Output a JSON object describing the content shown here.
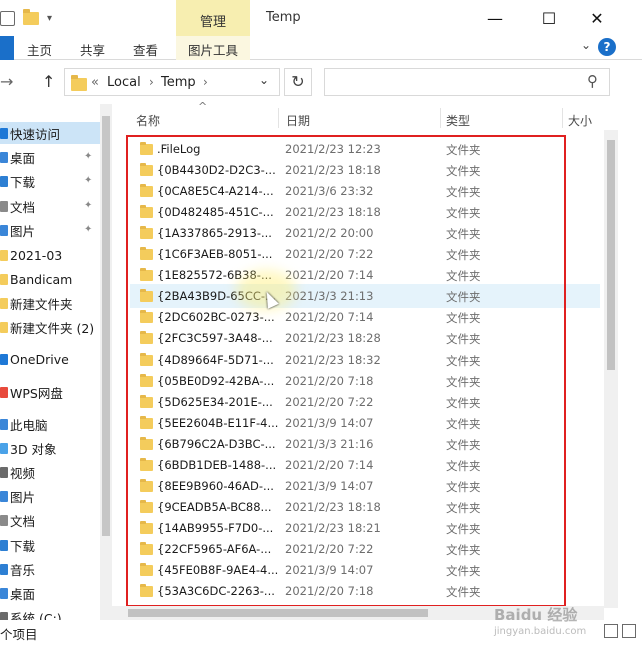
{
  "window": {
    "title": "Temp",
    "context_group": "管理",
    "minimize_glyph": "—",
    "maximize_glyph": "☐",
    "close_glyph": "✕"
  },
  "ribbon": {
    "tabs": [
      "主页",
      "共享",
      "查看"
    ],
    "context_tab": "图片工具",
    "collapse_glyph": "⌄",
    "help_glyph": "?"
  },
  "nav": {
    "back_glyph": "→",
    "up_glyph": "↑",
    "breadcrumb_prefix": "«",
    "breadcrumbs": [
      "Local",
      "Temp"
    ],
    "separator": "›",
    "dropdown_glyph": "⌄",
    "refresh_glyph": "↻",
    "search_placeholder": "",
    "search_glyph": "⚲"
  },
  "sidebar": {
    "items": [
      {
        "label": "快速访问",
        "icon": "star-icon",
        "color": "#1e78d6",
        "pinned": false,
        "active": true
      },
      {
        "label": "桌面",
        "icon": "desktop-icon",
        "color": "#3a86d8",
        "pinned": true,
        "active": false
      },
      {
        "label": "下载",
        "icon": "download-icon",
        "color": "#2d7fd3",
        "pinned": true,
        "active": false
      },
      {
        "label": "文档",
        "icon": "document-icon",
        "color": "#8a8a8a",
        "pinned": true,
        "active": false
      },
      {
        "label": "图片",
        "icon": "picture-icon",
        "color": "#3a86d8",
        "pinned": true,
        "active": false
      },
      {
        "label": "2021-03",
        "icon": "folder-icon",
        "color": "#f4cc5c",
        "pinned": false,
        "active": false
      },
      {
        "label": "Bandicam",
        "icon": "folder-icon",
        "color": "#f4cc5c",
        "pinned": false,
        "active": false
      },
      {
        "label": "新建文件夹",
        "icon": "folder-icon",
        "color": "#f4cc5c",
        "pinned": false,
        "active": false
      },
      {
        "label": "新建文件夹 (2)",
        "icon": "folder-icon",
        "color": "#f4cc5c",
        "pinned": false,
        "active": false
      },
      {
        "label": "OneDrive",
        "icon": "cloud-icon",
        "color": "#1e78d6",
        "pinned": false,
        "active": false
      },
      {
        "label": "WPS网盘",
        "icon": "cloud-icon",
        "color": "#e84a3c",
        "pinned": false,
        "active": false
      },
      {
        "label": "此电脑",
        "icon": "computer-icon",
        "color": "#3a86d8",
        "pinned": false,
        "active": false
      },
      {
        "label": "3D 对象",
        "icon": "cube-icon",
        "color": "#4aa2e8",
        "pinned": false,
        "active": false
      },
      {
        "label": "视频",
        "icon": "video-icon",
        "color": "#6a6a6a",
        "pinned": false,
        "active": false
      },
      {
        "label": "图片",
        "icon": "picture-icon",
        "color": "#3a86d8",
        "pinned": false,
        "active": false
      },
      {
        "label": "文档",
        "icon": "document-icon",
        "color": "#8a8a8a",
        "pinned": false,
        "active": false
      },
      {
        "label": "下载",
        "icon": "download-icon",
        "color": "#2d7fd3",
        "pinned": false,
        "active": false
      },
      {
        "label": "音乐",
        "icon": "music-icon",
        "color": "#2d7fd3",
        "pinned": false,
        "active": false
      },
      {
        "label": "桌面",
        "icon": "desktop-icon",
        "color": "#3a86d8",
        "pinned": false,
        "active": false
      },
      {
        "label": "系统 (C:)",
        "icon": "drive-icon",
        "color": "#6a6a6a",
        "pinned": false,
        "active": false
      }
    ],
    "pin_glyph": "✦"
  },
  "columns": {
    "name": "名称",
    "date": "日期",
    "type": "类型",
    "size": "大小",
    "sort_glyph": "^"
  },
  "files": [
    {
      "name": ".FileLog",
      "date": "2021/2/23 12:23",
      "type": "文件夹"
    },
    {
      "name": "{0B4430D2-D2C3-...",
      "date": "2021/2/23 18:18",
      "type": "文件夹"
    },
    {
      "name": "{0CA8E5C4-A214-...",
      "date": "2021/3/6 23:32",
      "type": "文件夹"
    },
    {
      "name": "{0D482485-451C-...",
      "date": "2021/2/23 18:18",
      "type": "文件夹"
    },
    {
      "name": "{1A337865-2913-...",
      "date": "2021/2/2 20:00",
      "type": "文件夹"
    },
    {
      "name": "{1C6F3AEB-8051-...",
      "date": "2021/2/20 7:22",
      "type": "文件夹"
    },
    {
      "name": "{1E825572-6B38-...",
      "date": "2021/2/20 7:14",
      "type": "文件夹"
    },
    {
      "name": "{2BA43B9D-65CC-...",
      "date": "2021/3/3 21:13",
      "type": "文件夹"
    },
    {
      "name": "{2DC602BC-0273-...",
      "date": "2021/2/20 7:14",
      "type": "文件夹"
    },
    {
      "name": "{2FC3C597-3A48-...",
      "date": "2021/2/23 18:28",
      "type": "文件夹"
    },
    {
      "name": "{4D89664F-5D71-...",
      "date": "2021/2/23 18:32",
      "type": "文件夹"
    },
    {
      "name": "{05BE0D92-42BA-...",
      "date": "2021/2/20 7:18",
      "type": "文件夹"
    },
    {
      "name": "{5D625E34-201E-...",
      "date": "2021/2/20 7:22",
      "type": "文件夹"
    },
    {
      "name": "{5EE2604B-E11F-4...",
      "date": "2021/3/9 14:07",
      "type": "文件夹"
    },
    {
      "name": "{6B796C2A-D3BC-...",
      "date": "2021/3/3 21:16",
      "type": "文件夹"
    },
    {
      "name": "{6BDB1DEB-1488-...",
      "date": "2021/2/20 7:14",
      "type": "文件夹"
    },
    {
      "name": "{8EE9B960-46AD-...",
      "date": "2021/3/9 14:07",
      "type": "文件夹"
    },
    {
      "name": "{9CEADB5A-BC88...",
      "date": "2021/2/23 18:18",
      "type": "文件夹"
    },
    {
      "name": "{14AB9955-F7D0-...",
      "date": "2021/2/23 18:21",
      "type": "文件夹"
    },
    {
      "name": "{22CF5965-AF6A-...",
      "date": "2021/2/20 7:22",
      "type": "文件夹"
    },
    {
      "name": "{45FE0B8F-9AE4-4...",
      "date": "2021/3/9 14:07",
      "type": "文件夹"
    },
    {
      "name": "{53A3C6DC-2263-...",
      "date": "2021/2/20 7:18",
      "type": "文件夹"
    }
  ],
  "hover_row": 7,
  "status": {
    "text": "个项目"
  },
  "watermark": {
    "brand": "Baidu 经验",
    "url": "jingyan.baidu.com"
  },
  "colors": {
    "accent": "#1a6fc9",
    "folder": "#f4cc5c",
    "selection": "#cce4f7",
    "hover": "#e5f3fb",
    "highlight_box": "#e02020",
    "context_tab": "#f7eeb0"
  }
}
